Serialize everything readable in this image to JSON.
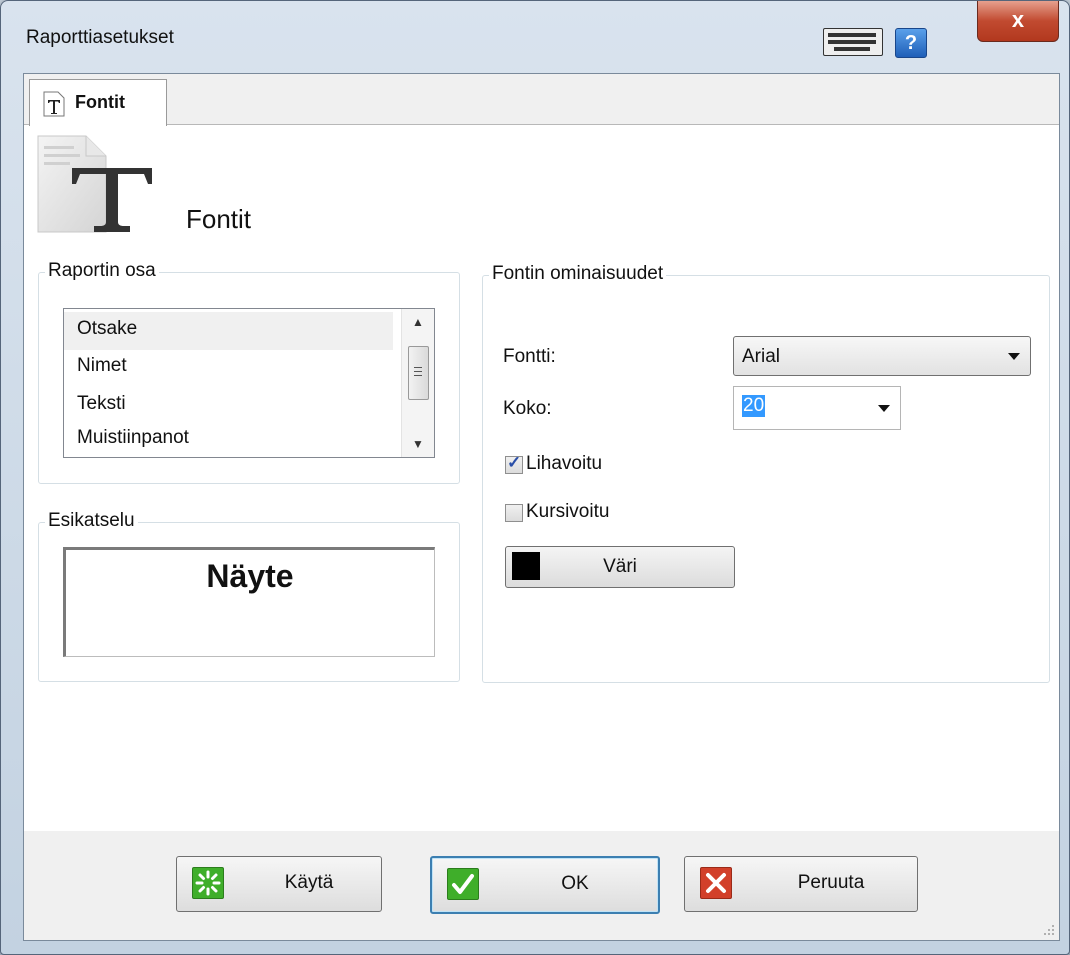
{
  "window": {
    "title": "Raporttiasetukset"
  },
  "tabs": [
    {
      "label": "Fontit"
    }
  ],
  "header": {
    "title": "Fontit"
  },
  "report_part": {
    "legend": "Raportin osa",
    "items": [
      "Otsake",
      "Nimet",
      "Teksti",
      "Muistiinpanot"
    ],
    "selected": "Otsake"
  },
  "preview": {
    "legend": "Esikatselu",
    "sample": "Näyte"
  },
  "font_props": {
    "legend": "Fontin ominaisuudet",
    "font_label": "Fontti:",
    "font_value": "Arial",
    "size_label": "Koko:",
    "size_value": "20",
    "bold_label": "Lihavoitu",
    "bold_checked": true,
    "italic_label": "Kursivoitu",
    "italic_checked": false,
    "color_label": "Väri",
    "color_value": "#000000"
  },
  "footer": {
    "apply_label": "Käytä",
    "ok_label": "OK",
    "cancel_label": "Peruuta"
  },
  "colors": {
    "apply_icon": "#3fae2a",
    "ok_icon": "#3fae2a",
    "cancel_icon": "#d2402a",
    "help_icon": "#2f77d0",
    "close_button": "#c14a30"
  }
}
